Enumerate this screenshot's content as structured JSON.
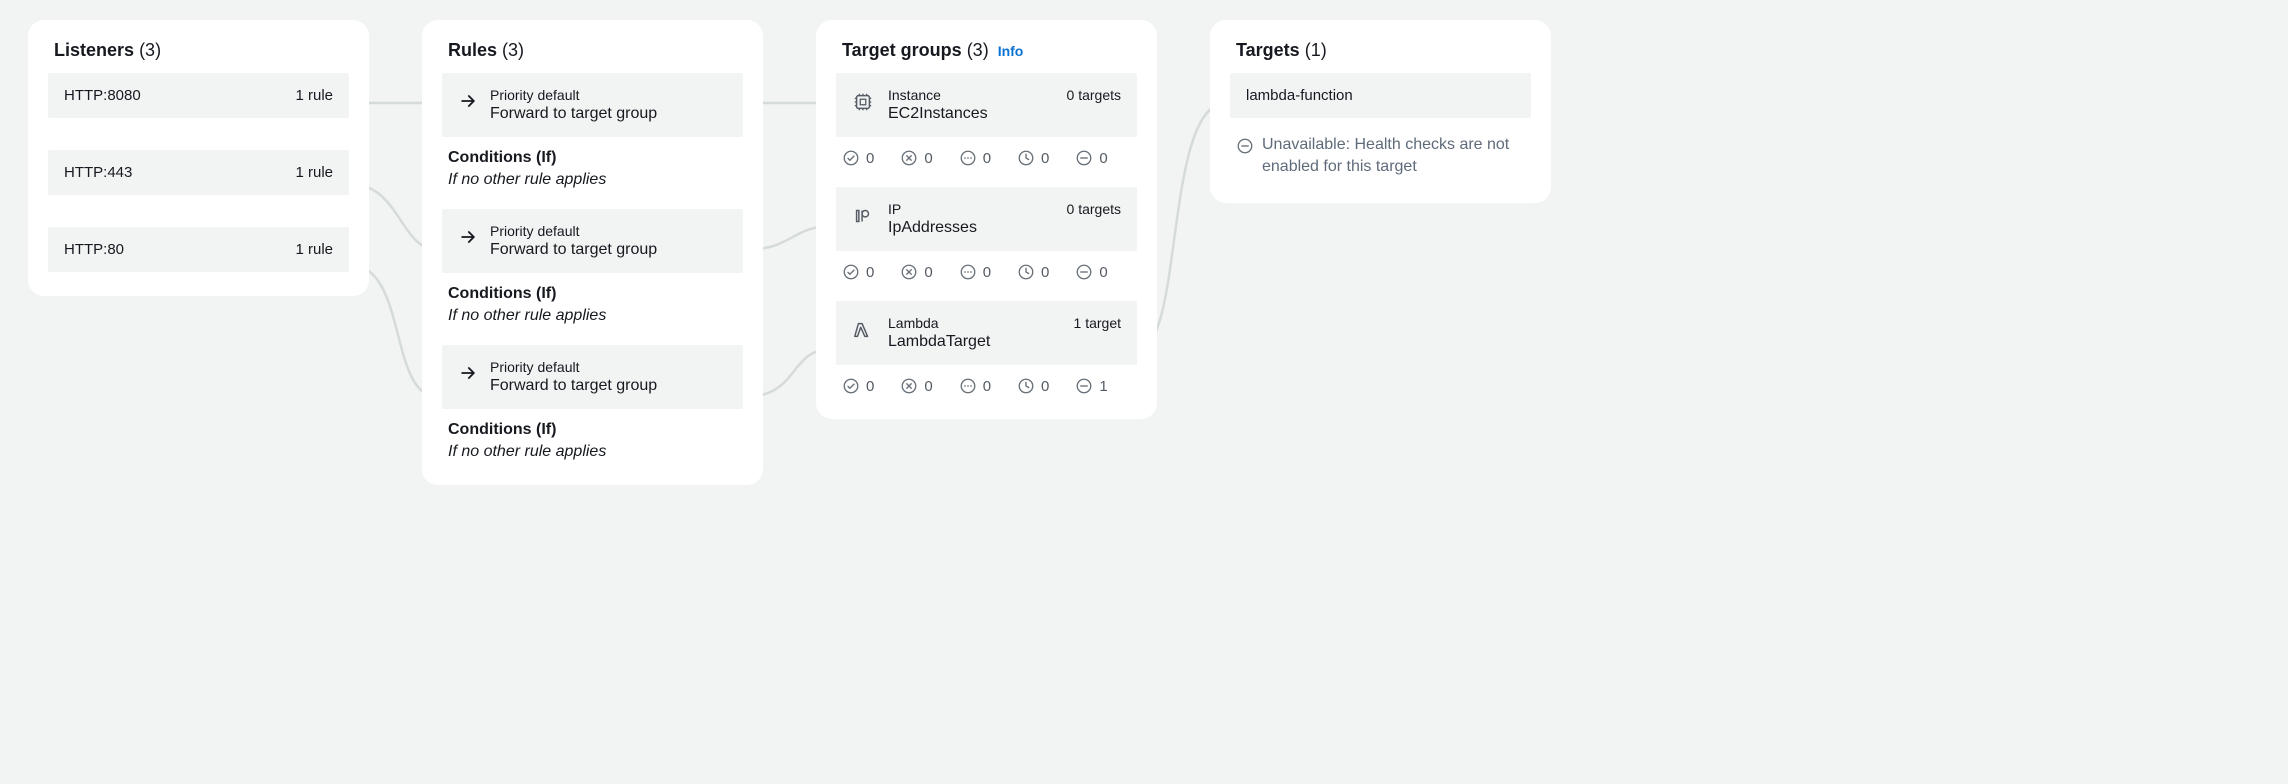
{
  "listeners": {
    "title": "Listeners",
    "count": "(3)",
    "items": [
      {
        "name": "HTTP:8080",
        "meta": "1 rule"
      },
      {
        "name": "HTTP:443",
        "meta": "1 rule"
      },
      {
        "name": "HTTP:80",
        "meta": "1 rule"
      }
    ]
  },
  "rules": {
    "title": "Rules",
    "count": "(3)",
    "cond_title": "Conditions (If)",
    "cond_text": "If no other rule applies",
    "items": [
      {
        "priority": "Priority default",
        "action": "Forward to target group"
      },
      {
        "priority": "Priority default",
        "action": "Forward to target group"
      },
      {
        "priority": "Priority default",
        "action": "Forward to target group"
      }
    ]
  },
  "target_groups": {
    "title": "Target groups",
    "count": "(3)",
    "info": "Info",
    "items": [
      {
        "type": "Instance",
        "name": "EC2Instances",
        "targets": "0 targets",
        "health": {
          "healthy": "0",
          "unhealthy": "0",
          "unused": "0",
          "draining": "0",
          "unavailable": "0"
        }
      },
      {
        "type": "IP",
        "name": "IpAddresses",
        "targets": "0 targets",
        "health": {
          "healthy": "0",
          "unhealthy": "0",
          "unused": "0",
          "draining": "0",
          "unavailable": "0"
        }
      },
      {
        "type": "Lambda",
        "name": "LambdaTarget",
        "targets": "1 target",
        "health": {
          "healthy": "0",
          "unhealthy": "0",
          "unused": "0",
          "draining": "0",
          "unavailable": "1"
        }
      }
    ]
  },
  "targets": {
    "title": "Targets",
    "count": "(1)",
    "items": [
      {
        "name": "lambda-function"
      }
    ],
    "status": "Unavailable: Health checks are not enabled for this target"
  }
}
